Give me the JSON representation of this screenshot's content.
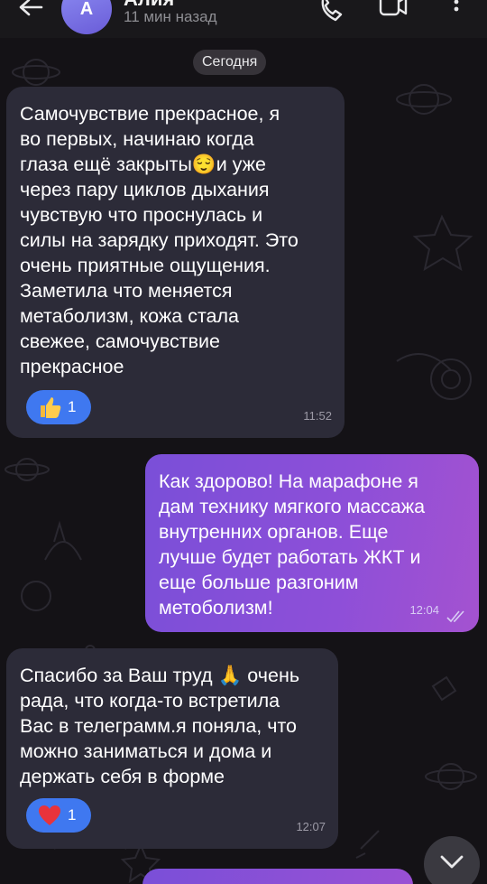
{
  "header": {
    "avatar_letter": "А",
    "contact_name": "Алия",
    "last_seen": "11 мин назад"
  },
  "date_divider": "Сегодня",
  "messages": [
    {
      "direction": "incoming",
      "text": "Самочувствие прекрасное, я\nво первых, начинаю когда\nглаза ещё закрыты😌и уже\nчерез пару циклов дыхания\nчувствую что проснулась и\nсилы на зарядку приходят. Это\nочень приятные ощущения.\nЗаметила что меняется\nметаболизм, кожа стала\nсвежее, самочувствие\nпрекрасное",
      "reaction": {
        "emoji": "thumbs-up",
        "count": "1"
      },
      "time": "11:52"
    },
    {
      "direction": "outgoing",
      "text": "Как здорово! На марафоне я\nдам технику  мягкого массажа\nвнутренних органов. Еще\nлучше будет работать ЖКТ и\nеще больше разгоним\nметоболизм!",
      "time": "12:04",
      "read": true
    },
    {
      "direction": "incoming",
      "text": "Спасибо за Ваш труд 🙏 очень\nрада, что когда-то встретила\nВас в телеграмм.я поняла, что\nможно заниматься и дома и\nдержать себя в форме",
      "reaction": {
        "emoji": "heart",
        "count": "1"
      },
      "time": "12:07"
    }
  ],
  "colors": {
    "background": "#141216",
    "incoming_bubble": "#2c2b38",
    "outgoing_bubble": "#8e4fd8",
    "reaction": "#3f78f0"
  },
  "icons": [
    "back-arrow-icon",
    "phone-icon",
    "video-camera-icon",
    "more-vertical-icon",
    "double-check-icon",
    "chevron-down-icon"
  ]
}
